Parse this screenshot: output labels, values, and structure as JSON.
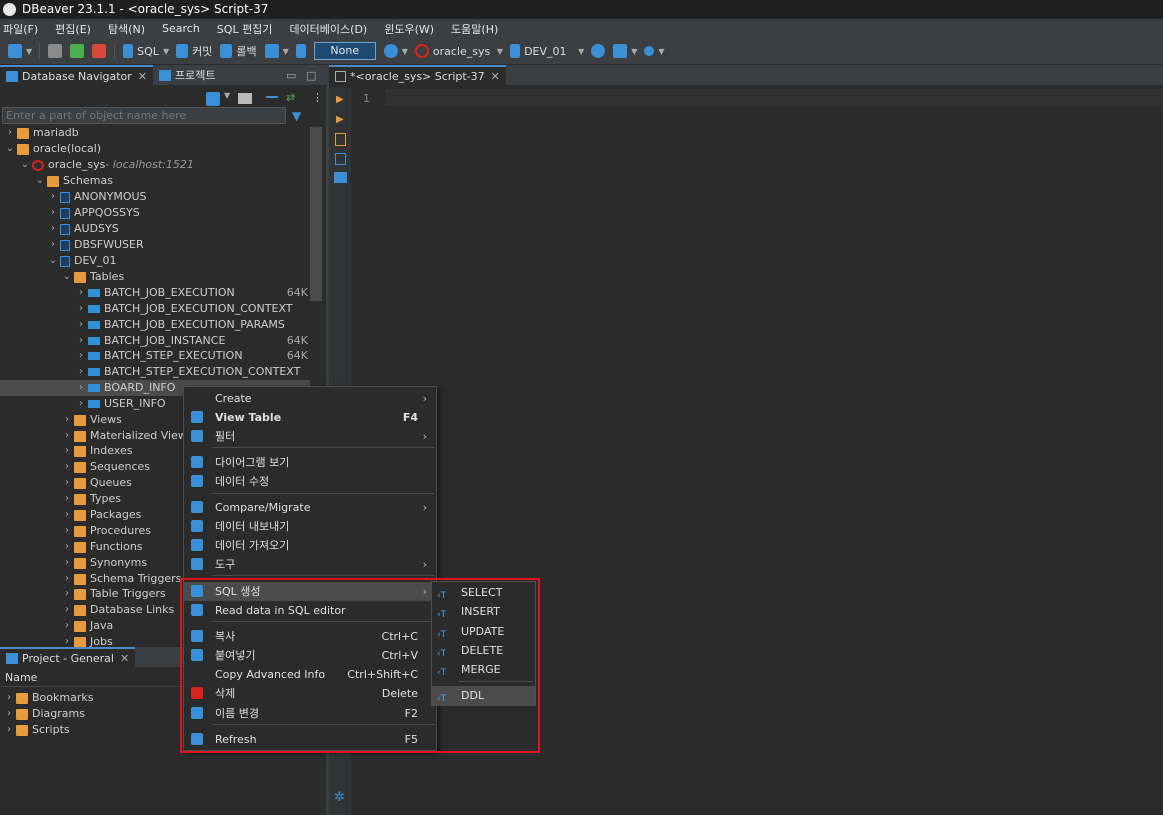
{
  "window": {
    "title": "DBeaver 23.1.1 - <oracle_sys> Script-37"
  },
  "menu": [
    "파일(F)",
    "편집(E)",
    "탐색(N)",
    "Search",
    "SQL 편집기",
    "데이터베이스(D)",
    "윈도우(W)",
    "도움말(H)"
  ],
  "toolbar": {
    "sql_label": "SQL",
    "commit_label": "커밋",
    "rollback_label": "롤백",
    "tx_mode": "None",
    "connection": "oracle_sys",
    "schema": "DEV_01"
  },
  "navigator": {
    "tab_label": "Database Navigator",
    "project_tab_label": "프로젝트",
    "filter_placeholder": "Enter a part of object name here",
    "tree": [
      {
        "label": "mariadb",
        "connection": "",
        "size": ""
      },
      {
        "label": "oracle(local)",
        "connection": "",
        "size": ""
      },
      {
        "label": "oracle_sys",
        "connection": " - localhost:1521",
        "size": ""
      },
      {
        "label": "Schemas",
        "connection": "",
        "size": ""
      },
      {
        "label": "ANONYMOUS",
        "connection": "",
        "size": ""
      },
      {
        "label": "APPQOSSYS",
        "connection": "",
        "size": ""
      },
      {
        "label": "AUDSYS",
        "connection": "",
        "size": ""
      },
      {
        "label": "DBSFWUSER",
        "connection": "",
        "size": ""
      },
      {
        "label": "DEV_01",
        "connection": "",
        "size": ""
      },
      {
        "label": "Tables",
        "connection": "",
        "size": ""
      },
      {
        "label": "BATCH_JOB_EXECUTION",
        "connection": "",
        "size": "64K"
      },
      {
        "label": "BATCH_JOB_EXECUTION_CONTEXT",
        "connection": "",
        "size": ""
      },
      {
        "label": "BATCH_JOB_EXECUTION_PARAMS",
        "connection": "",
        "size": ""
      },
      {
        "label": "BATCH_JOB_INSTANCE",
        "connection": "",
        "size": "64K"
      },
      {
        "label": "BATCH_STEP_EXECUTION",
        "connection": "",
        "size": "64K"
      },
      {
        "label": "BATCH_STEP_EXECUTION_CONTEXT",
        "connection": "",
        "size": ""
      },
      {
        "label": "BOARD_INFO",
        "connection": "",
        "size": ""
      },
      {
        "label": "USER_INFO",
        "connection": "",
        "size": ""
      },
      {
        "label": "Views",
        "connection": "",
        "size": ""
      },
      {
        "label": "Materialized Views",
        "connection": "",
        "size": ""
      },
      {
        "label": "Indexes",
        "connection": "",
        "size": ""
      },
      {
        "label": "Sequences",
        "connection": "",
        "size": ""
      },
      {
        "label": "Queues",
        "connection": "",
        "size": ""
      },
      {
        "label": "Types",
        "connection": "",
        "size": ""
      },
      {
        "label": "Packages",
        "connection": "",
        "size": ""
      },
      {
        "label": "Procedures",
        "connection": "",
        "size": ""
      },
      {
        "label": "Functions",
        "connection": "",
        "size": ""
      },
      {
        "label": "Synonyms",
        "connection": "",
        "size": ""
      },
      {
        "label": "Schema Triggers",
        "connection": "",
        "size": ""
      },
      {
        "label": "Table Triggers",
        "connection": "",
        "size": ""
      },
      {
        "label": "Database Links",
        "connection": "",
        "size": ""
      },
      {
        "label": "Java",
        "connection": "",
        "size": ""
      },
      {
        "label": "Jobs",
        "connection": "",
        "size": ""
      }
    ]
  },
  "project": {
    "tab_label": "Project - General",
    "column": "Name",
    "items": [
      "Bookmarks",
      "Diagrams",
      "Scripts"
    ]
  },
  "editor": {
    "tab_label": "*<oracle_sys> Script-37",
    "line_number": "1"
  },
  "context_menu": [
    {
      "label": "Create",
      "shortcut": "",
      "submenu": true
    },
    {
      "label": "View Table",
      "shortcut": "F4",
      "submenu": false
    },
    {
      "label": "필터",
      "shortcut": "",
      "submenu": true
    },
    {
      "label": "다이어그램 보기",
      "shortcut": "",
      "submenu": false
    },
    {
      "label": "데이터 수정",
      "shortcut": "",
      "submenu": false
    },
    {
      "label": "Compare/Migrate",
      "shortcut": "",
      "submenu": true
    },
    {
      "label": "데이터 내보내기",
      "shortcut": "",
      "submenu": false
    },
    {
      "label": "데이터 가져오기",
      "shortcut": "",
      "submenu": false
    },
    {
      "label": "도구",
      "shortcut": "",
      "submenu": true
    },
    {
      "label": "SQL 생성",
      "shortcut": "",
      "submenu": true
    },
    {
      "label": "Read data in SQL editor",
      "shortcut": "",
      "submenu": false
    },
    {
      "label": "복사",
      "shortcut": "Ctrl+C",
      "submenu": false
    },
    {
      "label": "붙여넣기",
      "shortcut": "Ctrl+V",
      "submenu": false
    },
    {
      "label": "Copy Advanced Info",
      "shortcut": "Ctrl+Shift+C",
      "submenu": false
    },
    {
      "label": "삭제",
      "shortcut": "Delete",
      "submenu": false
    },
    {
      "label": "이름 변경",
      "shortcut": "F2",
      "submenu": false
    },
    {
      "label": "Refresh",
      "shortcut": "F5",
      "submenu": false
    }
  ],
  "sql_submenu": [
    "SELECT",
    "INSERT",
    "UPDATE",
    "DELETE",
    "MERGE",
    "DDL"
  ],
  "colors": {
    "accent": "#4a88c7",
    "highlight_box": "#e0141b",
    "folder": "#e89b3c"
  }
}
